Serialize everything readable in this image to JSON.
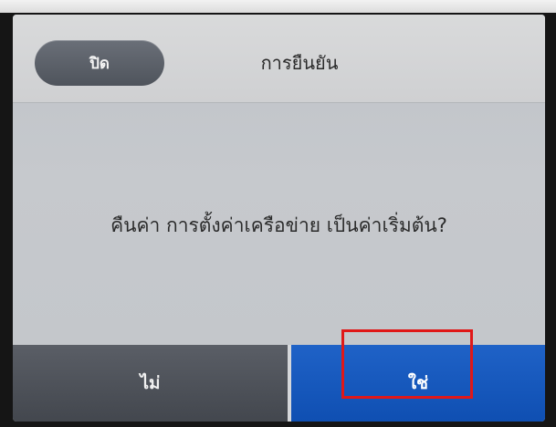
{
  "dialog": {
    "close_label": "ปิด",
    "title": "การยืนยัน",
    "message": "คืนค่า การตั้งค่าเครือข่าย เป็นค่าเริ่มต้น?"
  },
  "actions": {
    "no_label": "ไม่",
    "yes_label": "ใช่"
  },
  "colors": {
    "yes_button": "#1558bf",
    "no_button": "#4d5159",
    "close_button": "#5c616a",
    "highlight": "#e01818"
  }
}
